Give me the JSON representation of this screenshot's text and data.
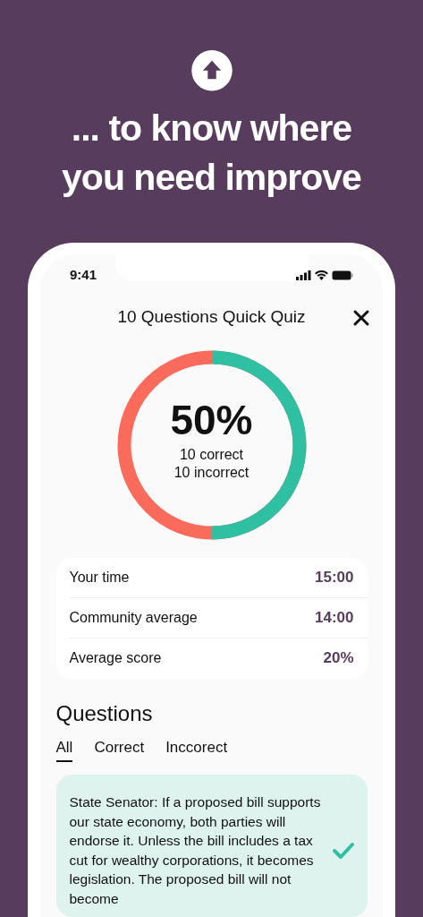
{
  "headline": [
    "... to know where",
    "you need improve"
  ],
  "status_bar": {
    "time": "9:41"
  },
  "header": {
    "title": "10 Questions Quick Quiz"
  },
  "result": {
    "level": 0.5,
    "percent": "50%",
    "correct": "10 correct",
    "incorrect": "10 incorrect"
  },
  "stats": [
    {
      "label": "Your time",
      "value": "15:00"
    },
    {
      "label": "Community average",
      "value": "14:00"
    },
    {
      "label": "Average score",
      "value": "20%"
    }
  ],
  "questions": {
    "title": "Questions",
    "tabs": [
      {
        "label": "All",
        "selected": true
      },
      {
        "label": "Correct",
        "selected": false
      },
      {
        "label": "Inccorect",
        "selected": false
      }
    ],
    "items": [
      {
        "text": "State Senator: If a proposed bill supports our state economy, both parties will endorse it. Unless the bill includes a tax cut for wealthy corporations, it becomes legislation. The proposed bill will not become",
        "correct": true
      }
    ]
  }
}
